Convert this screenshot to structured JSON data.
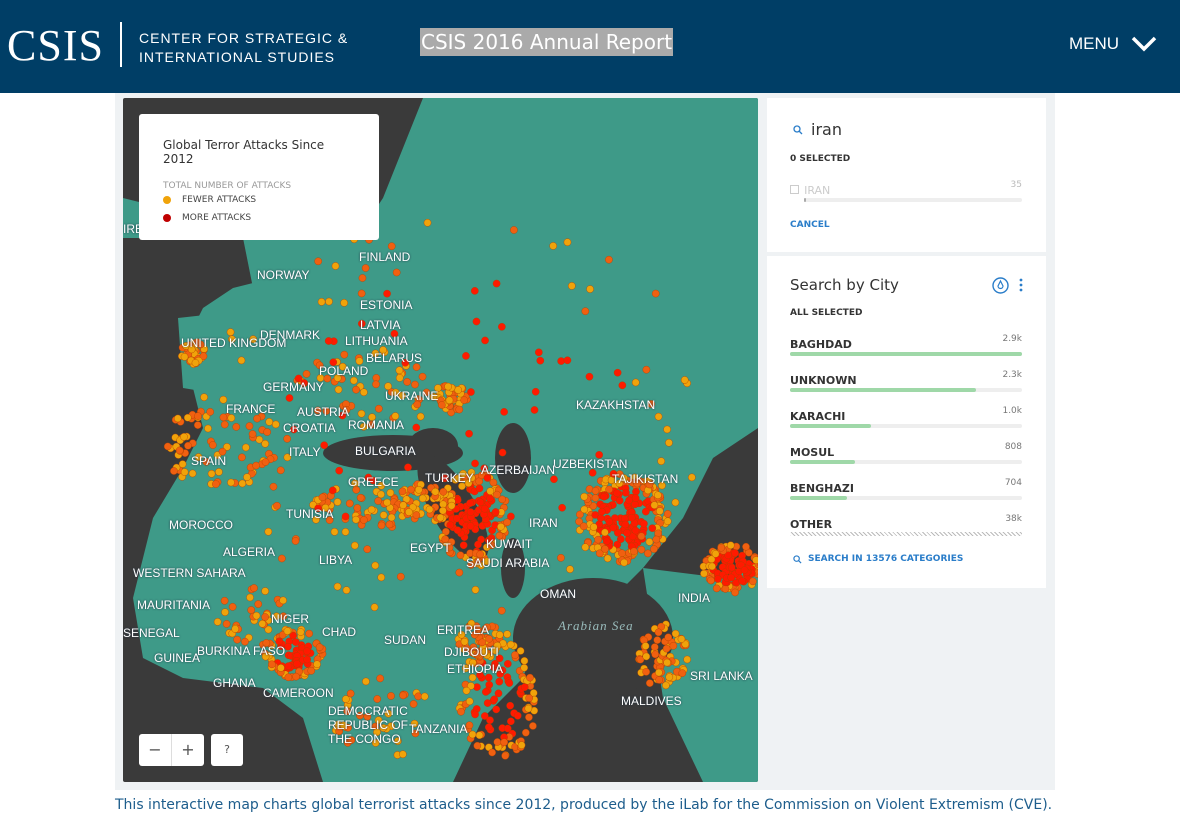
{
  "header": {
    "logo": "CSIS",
    "logo_sub_1": "CENTER FOR STRATEGIC &",
    "logo_sub_2": "INTERNATIONAL STUDIES",
    "report_title": "CSIS 2016 Annual Report",
    "menu": "MENU"
  },
  "legend": {
    "title": "Global Terror Attacks Since 2012",
    "subtitle": "TOTAL NUMBER OF ATTACKS",
    "items": [
      {
        "label": "FEWER ATTACKS",
        "color": "#f0a30a"
      },
      {
        "label": "MORE ATTACKS",
        "color": "#c00000"
      }
    ]
  },
  "map": {
    "land_color": "#3e9a88",
    "water_color": "#3a3a3a",
    "labels": [
      "FINLAND",
      "NORWAY",
      "ESTONIA",
      "LATVIA",
      "LITHUANIA",
      "DENMARK",
      "UNITED KINGDOM",
      "BELARUS",
      "POLAND",
      "GERMANY",
      "UKRAINE",
      "FRANCE",
      "AUSTRIA",
      "CROATIA",
      "ROMANIA",
      "KAZAKHSTAN",
      "SPAIN",
      "ITALY",
      "BULGARIA",
      "GREECE",
      "UZBEKISTAN",
      "AZERBAIJAN",
      "TURKEY",
      "TAJIKISTAN",
      "TUNISIA",
      "MOROCCO",
      "IRAN",
      "ALGERIA",
      "LIBYA",
      "KUWAIT",
      "EGYPT",
      "SAUDI ARABIA",
      "WESTERN SAHARA",
      "OMAN",
      "INDIA",
      "MAURITANIA",
      "NIGER",
      "SENEGAL",
      "CHAD",
      "SUDAN",
      "ERITREA",
      "BURKINA FASO",
      "DJIBOUTI",
      "GUINEA",
      "ETHIOPIA",
      "GHANA",
      "CAMEROON",
      "SRI LANKA",
      "MALDIVES",
      "DEMOCRATIC REPUBLIC OF THE CONGO",
      "TANZANIA",
      "IRELAND"
    ],
    "sea": "Arabian Sea",
    "zoom_out": "−",
    "zoom_in": "+",
    "help": "?"
  },
  "filter": {
    "query": "iran",
    "selected": "0 SELECTED",
    "items": [
      {
        "name": "IRAN",
        "count": "35",
        "fraction": 0.01
      }
    ],
    "cancel": "CANCEL"
  },
  "city": {
    "title": "Search by City",
    "selected": "ALL SELECTED",
    "items": [
      {
        "name": "BAGHDAD",
        "count": "2.9k",
        "fraction": 1.0
      },
      {
        "name": "UNKNOWN",
        "count": "2.3k",
        "fraction": 0.8
      },
      {
        "name": "KARACHI",
        "count": "1.0k",
        "fraction": 0.35
      },
      {
        "name": "MOSUL",
        "count": "808",
        "fraction": 0.28
      },
      {
        "name": "BENGHAZI",
        "count": "704",
        "fraction": 0.245
      },
      {
        "name": "OTHER",
        "count": "38k",
        "fraction": null
      }
    ],
    "search": "SEARCH IN 13576 CATEGORIES",
    "accent": "#2a7dc9"
  },
  "caption": "This interactive map charts global terrorist attacks since 2012, produced by the iLab for the Commission on Violent Extremism (CVE)."
}
